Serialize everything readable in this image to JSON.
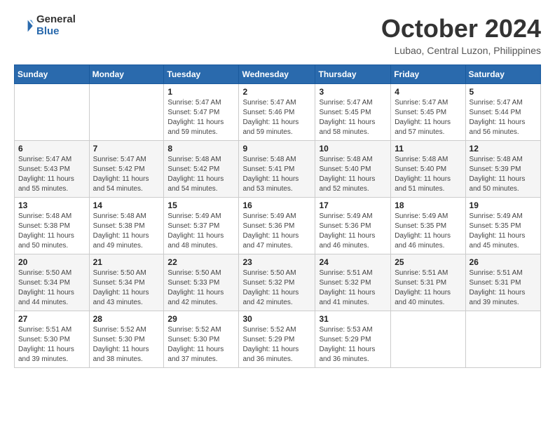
{
  "logo": {
    "general": "General",
    "blue": "Blue"
  },
  "header": {
    "month": "October 2024",
    "location": "Lubao, Central Luzon, Philippines"
  },
  "weekdays": [
    "Sunday",
    "Monday",
    "Tuesday",
    "Wednesday",
    "Thursday",
    "Friday",
    "Saturday"
  ],
  "weeks": [
    [
      {
        "day": "",
        "info": ""
      },
      {
        "day": "",
        "info": ""
      },
      {
        "day": "1",
        "info": "Sunrise: 5:47 AM\nSunset: 5:47 PM\nDaylight: 11 hours and 59 minutes."
      },
      {
        "day": "2",
        "info": "Sunrise: 5:47 AM\nSunset: 5:46 PM\nDaylight: 11 hours and 59 minutes."
      },
      {
        "day": "3",
        "info": "Sunrise: 5:47 AM\nSunset: 5:45 PM\nDaylight: 11 hours and 58 minutes."
      },
      {
        "day": "4",
        "info": "Sunrise: 5:47 AM\nSunset: 5:45 PM\nDaylight: 11 hours and 57 minutes."
      },
      {
        "day": "5",
        "info": "Sunrise: 5:47 AM\nSunset: 5:44 PM\nDaylight: 11 hours and 56 minutes."
      }
    ],
    [
      {
        "day": "6",
        "info": "Sunrise: 5:47 AM\nSunset: 5:43 PM\nDaylight: 11 hours and 55 minutes."
      },
      {
        "day": "7",
        "info": "Sunrise: 5:47 AM\nSunset: 5:42 PM\nDaylight: 11 hours and 54 minutes."
      },
      {
        "day": "8",
        "info": "Sunrise: 5:48 AM\nSunset: 5:42 PM\nDaylight: 11 hours and 54 minutes."
      },
      {
        "day": "9",
        "info": "Sunrise: 5:48 AM\nSunset: 5:41 PM\nDaylight: 11 hours and 53 minutes."
      },
      {
        "day": "10",
        "info": "Sunrise: 5:48 AM\nSunset: 5:40 PM\nDaylight: 11 hours and 52 minutes."
      },
      {
        "day": "11",
        "info": "Sunrise: 5:48 AM\nSunset: 5:40 PM\nDaylight: 11 hours and 51 minutes."
      },
      {
        "day": "12",
        "info": "Sunrise: 5:48 AM\nSunset: 5:39 PM\nDaylight: 11 hours and 50 minutes."
      }
    ],
    [
      {
        "day": "13",
        "info": "Sunrise: 5:48 AM\nSunset: 5:38 PM\nDaylight: 11 hours and 50 minutes."
      },
      {
        "day": "14",
        "info": "Sunrise: 5:48 AM\nSunset: 5:38 PM\nDaylight: 11 hours and 49 minutes."
      },
      {
        "day": "15",
        "info": "Sunrise: 5:49 AM\nSunset: 5:37 PM\nDaylight: 11 hours and 48 minutes."
      },
      {
        "day": "16",
        "info": "Sunrise: 5:49 AM\nSunset: 5:36 PM\nDaylight: 11 hours and 47 minutes."
      },
      {
        "day": "17",
        "info": "Sunrise: 5:49 AM\nSunset: 5:36 PM\nDaylight: 11 hours and 46 minutes."
      },
      {
        "day": "18",
        "info": "Sunrise: 5:49 AM\nSunset: 5:35 PM\nDaylight: 11 hours and 46 minutes."
      },
      {
        "day": "19",
        "info": "Sunrise: 5:49 AM\nSunset: 5:35 PM\nDaylight: 11 hours and 45 minutes."
      }
    ],
    [
      {
        "day": "20",
        "info": "Sunrise: 5:50 AM\nSunset: 5:34 PM\nDaylight: 11 hours and 44 minutes."
      },
      {
        "day": "21",
        "info": "Sunrise: 5:50 AM\nSunset: 5:34 PM\nDaylight: 11 hours and 43 minutes."
      },
      {
        "day": "22",
        "info": "Sunrise: 5:50 AM\nSunset: 5:33 PM\nDaylight: 11 hours and 42 minutes."
      },
      {
        "day": "23",
        "info": "Sunrise: 5:50 AM\nSunset: 5:32 PM\nDaylight: 11 hours and 42 minutes."
      },
      {
        "day": "24",
        "info": "Sunrise: 5:51 AM\nSunset: 5:32 PM\nDaylight: 11 hours and 41 minutes."
      },
      {
        "day": "25",
        "info": "Sunrise: 5:51 AM\nSunset: 5:31 PM\nDaylight: 11 hours and 40 minutes."
      },
      {
        "day": "26",
        "info": "Sunrise: 5:51 AM\nSunset: 5:31 PM\nDaylight: 11 hours and 39 minutes."
      }
    ],
    [
      {
        "day": "27",
        "info": "Sunrise: 5:51 AM\nSunset: 5:30 PM\nDaylight: 11 hours and 39 minutes."
      },
      {
        "day": "28",
        "info": "Sunrise: 5:52 AM\nSunset: 5:30 PM\nDaylight: 11 hours and 38 minutes."
      },
      {
        "day": "29",
        "info": "Sunrise: 5:52 AM\nSunset: 5:30 PM\nDaylight: 11 hours and 37 minutes."
      },
      {
        "day": "30",
        "info": "Sunrise: 5:52 AM\nSunset: 5:29 PM\nDaylight: 11 hours and 36 minutes."
      },
      {
        "day": "31",
        "info": "Sunrise: 5:53 AM\nSunset: 5:29 PM\nDaylight: 11 hours and 36 minutes."
      },
      {
        "day": "",
        "info": ""
      },
      {
        "day": "",
        "info": ""
      }
    ]
  ]
}
